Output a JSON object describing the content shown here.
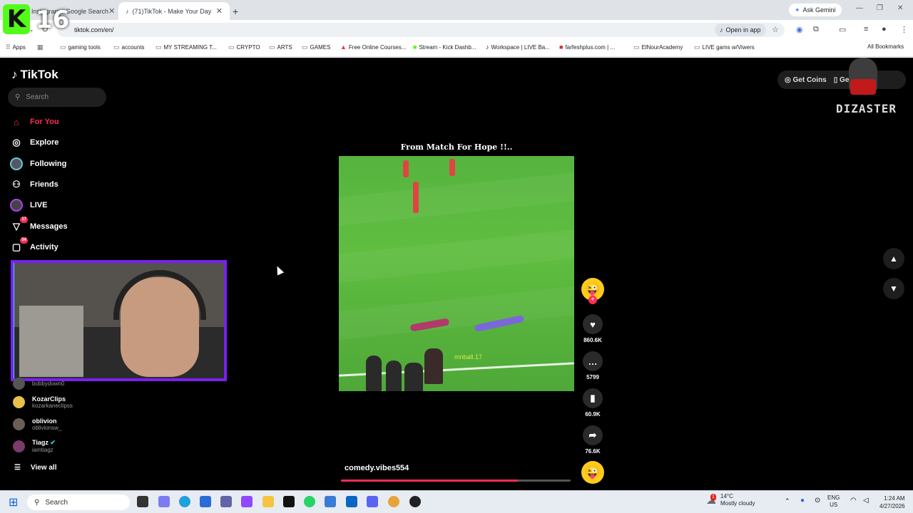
{
  "browser": {
    "tabs": [
      {
        "label": "Instagram - Google Search"
      },
      {
        "label": "(71)TikTok - Make Your Day"
      }
    ],
    "ask_gemini": "Ask Gemini",
    "url": "tiktok.com/en/",
    "open_in_app": "Open in app",
    "bookmarks": [
      "Apps",
      "gaming tools",
      "accounts",
      "MY STREAMING T...",
      "CRYPTO",
      "ARTS",
      "GAMES",
      "Free Online Courses...",
      "Stream - Kick Dashb...",
      "Workspace | LIVE Ba...",
      "farfeshplus.com | ...",
      "ElNourAcademy",
      "LIVE gams w/Viwers",
      "All Bookmarks"
    ]
  },
  "overlay": {
    "kick_letter": "K",
    "kick_number": "16",
    "streamer_logo_text": "DIZASTER"
  },
  "sidebar": {
    "logo": "TikTok",
    "search_placeholder": "Search",
    "nav": [
      {
        "label": "For You",
        "icon": "home-icon"
      },
      {
        "label": "Explore",
        "icon": "compass-icon"
      },
      {
        "label": "Following",
        "icon": "following-avatar-icon"
      },
      {
        "label": "Friends",
        "icon": "friends-icon"
      },
      {
        "label": "LIVE",
        "icon": "live-icon"
      },
      {
        "label": "Messages",
        "icon": "send-icon",
        "badge": "17"
      },
      {
        "label": "Activity",
        "icon": "inbox-icon",
        "badge": "54"
      }
    ],
    "accounts": [
      {
        "name": "",
        "handle": "bobbydown0"
      },
      {
        "name": "KozarClips",
        "handle": "kozarkaneclipss"
      },
      {
        "name": "oblivion",
        "handle": "oblivionsw_"
      },
      {
        "name": "Tiagz",
        "handle": "iamtiagz"
      }
    ],
    "view_all": "View all"
  },
  "topright": {
    "get_coins": "Get Coins",
    "get_app": "Ge"
  },
  "video": {
    "title": "From Match For Hope !!..",
    "watermark": "mnball.17",
    "author": "comedy.vibes554",
    "progress_fraction": 0.77
  },
  "actions": {
    "likes": "860.6K",
    "comments": "5799",
    "saves": "60.9K",
    "shares": "76.6K"
  },
  "taskbar": {
    "search": "Search",
    "weather_temp": "14°C",
    "weather_desc": "Mostly cloudy",
    "weather_badge": "1",
    "lang": "ENG",
    "region": "US",
    "time": "1:24 AM",
    "date": "4/27/2026"
  }
}
